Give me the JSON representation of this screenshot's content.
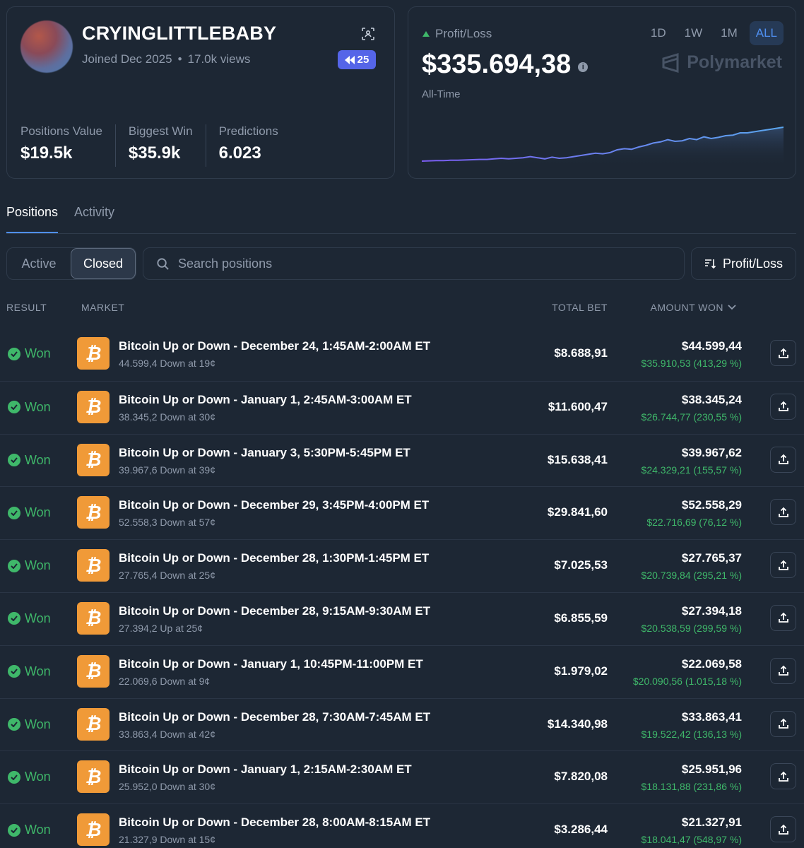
{
  "profile": {
    "username": "CRYINGLITTLEBABY",
    "joined": "Joined Dec 2025",
    "views": "17.0k views",
    "badge": "25",
    "stats": [
      {
        "label": "Positions Value",
        "value": "$19.5k"
      },
      {
        "label": "Biggest Win",
        "value": "$35.9k"
      },
      {
        "label": "Predictions",
        "value": "6.023"
      }
    ]
  },
  "pnl": {
    "label": "Profit/Loss",
    "value": "$335.694,38",
    "period": "All-Time",
    "brand": "Polymarket",
    "ranges": [
      "1D",
      "1W",
      "1M",
      "ALL"
    ],
    "active_range": "ALL",
    "chart_series": [
      20,
      20.5,
      21,
      21,
      21.5,
      21.5,
      22,
      22.5,
      23,
      23,
      24,
      25,
      24,
      25,
      26,
      28,
      26,
      24,
      27,
      25,
      26,
      28,
      30,
      32,
      34,
      33,
      35,
      40,
      42,
      41,
      45,
      48,
      52,
      54,
      58,
      55,
      56,
      60,
      58,
      63,
      60,
      62,
      65,
      66,
      70,
      70,
      72,
      74,
      76,
      78,
      80
    ]
  },
  "tabs": [
    "Positions",
    "Activity"
  ],
  "filters": {
    "active_label": "Active",
    "closed_label": "Closed",
    "search_placeholder": "Search positions",
    "sort_label": "Profit/Loss"
  },
  "table": {
    "headers": {
      "result": "RESULT",
      "market": "MARKET",
      "total_bet": "TOTAL BET",
      "amount_won": "AMOUNT WON"
    },
    "rows": [
      {
        "result": "Won",
        "title": "Bitcoin Up or Down - December 24, 1:45AM-2:00AM ET",
        "sub": "44.599,4 Down at 19¢",
        "bet": "$8.688,91",
        "won": "$44.599,44",
        "profit": "$35.910,53 (413,29 %)"
      },
      {
        "result": "Won",
        "title": "Bitcoin Up or Down - January 1, 2:45AM-3:00AM ET",
        "sub": "38.345,2 Down at 30¢",
        "bet": "$11.600,47",
        "won": "$38.345,24",
        "profit": "$26.744,77 (230,55 %)"
      },
      {
        "result": "Won",
        "title": "Bitcoin Up or Down - January 3, 5:30PM-5:45PM ET",
        "sub": "39.967,6 Down at 39¢",
        "bet": "$15.638,41",
        "won": "$39.967,62",
        "profit": "$24.329,21 (155,57 %)"
      },
      {
        "result": "Won",
        "title": "Bitcoin Up or Down - December 29, 3:45PM-4:00PM ET",
        "sub": "52.558,3 Down at 57¢",
        "bet": "$29.841,60",
        "won": "$52.558,29",
        "profit": "$22.716,69 (76,12 %)"
      },
      {
        "result": "Won",
        "title": "Bitcoin Up or Down - December 28, 1:30PM-1:45PM ET",
        "sub": "27.765,4 Down at 25¢",
        "bet": "$7.025,53",
        "won": "$27.765,37",
        "profit": "$20.739,84 (295,21 %)"
      },
      {
        "result": "Won",
        "title": "Bitcoin Up or Down - December 28, 9:15AM-9:30AM ET",
        "sub": "27.394,2 Up at 25¢",
        "bet": "$6.855,59",
        "won": "$27.394,18",
        "profit": "$20.538,59 (299,59 %)"
      },
      {
        "result": "Won",
        "title": "Bitcoin Up or Down - January 1, 10:45PM-11:00PM ET",
        "sub": "22.069,6 Down at 9¢",
        "bet": "$1.979,02",
        "won": "$22.069,58",
        "profit": "$20.090,56 (1.015,18 %)"
      },
      {
        "result": "Won",
        "title": "Bitcoin Up or Down - December 28, 7:30AM-7:45AM ET",
        "sub": "33.863,4 Down at 42¢",
        "bet": "$14.340,98",
        "won": "$33.863,41",
        "profit": "$19.522,42 (136,13 %)"
      },
      {
        "result": "Won",
        "title": "Bitcoin Up or Down - January 1, 2:15AM-2:30AM ET",
        "sub": "25.952,0 Down at 30¢",
        "bet": "$7.820,08",
        "won": "$25.951,96",
        "profit": "$18.131,88 (231,86 %)"
      },
      {
        "result": "Won",
        "title": "Bitcoin Up or Down - December 28, 8:00AM-8:15AM ET",
        "sub": "21.327,9 Down at 15¢",
        "bet": "$3.286,44",
        "won": "$21.327,91",
        "profit": "$18.041,47 (548,97 %)"
      }
    ]
  },
  "colors": {
    "accent": "#4f8ff0",
    "win": "#3fb86a",
    "btc": "#f09a38",
    "badge": "#5565e8"
  },
  "icons": {
    "check": "check-circle-icon",
    "btc": "bitcoin-icon",
    "share": "share-icon",
    "search": "search-icon",
    "sort": "sort-icon",
    "scan": "qr-scan-icon",
    "info": "info-icon"
  }
}
